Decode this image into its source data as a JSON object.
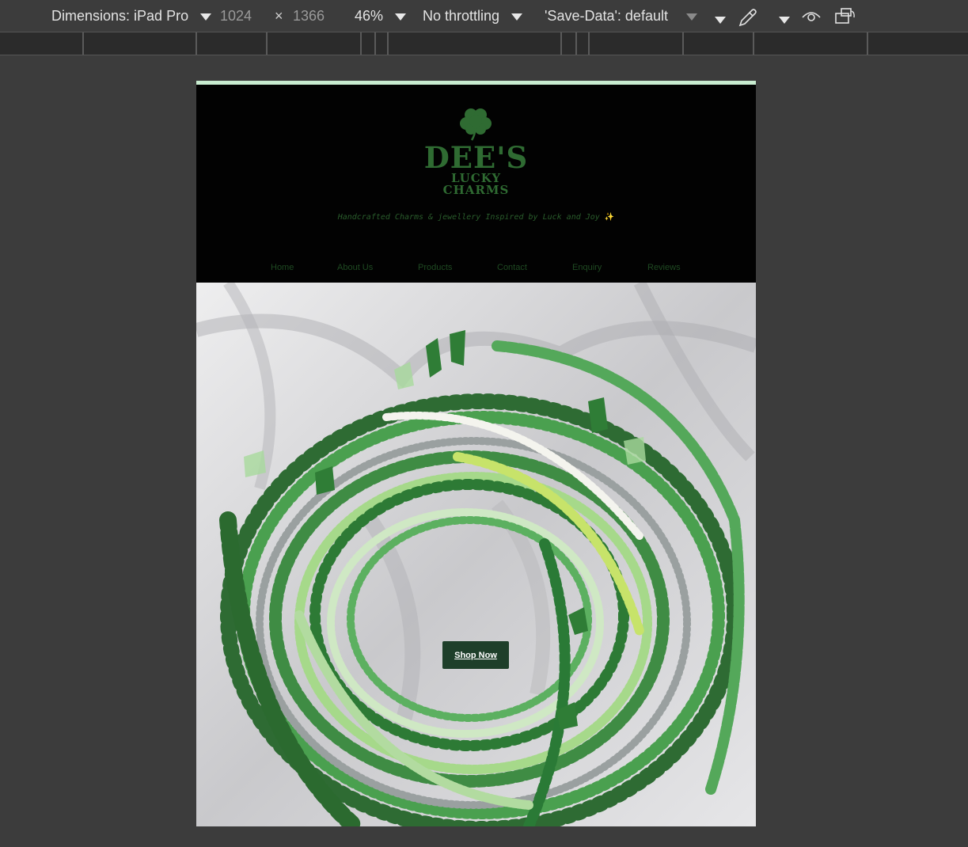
{
  "devtools": {
    "dimensions_label": "Dimensions: iPad Pro",
    "width": "1024",
    "times": "×",
    "height": "1366",
    "zoom": "46%",
    "throttling": "No throttling",
    "save_data": "'Save-Data': default"
  },
  "site": {
    "logo_main": "DEE'S",
    "logo_sub_1": "LUCKY",
    "logo_sub_2": "CHARMS",
    "tagline": "Handcrafted Charms & jewellery Inspired by Luck and Joy",
    "tagline_emoji": "✨",
    "nav": [
      "Home",
      "About Us",
      "Products",
      "Contact",
      "Enquiry",
      "Reviews"
    ],
    "cta": "Shop Now"
  },
  "colors": {
    "brand_green": "#2f6b32",
    "header_bg": "#020202",
    "cta_bg": "#1e3f2a"
  }
}
